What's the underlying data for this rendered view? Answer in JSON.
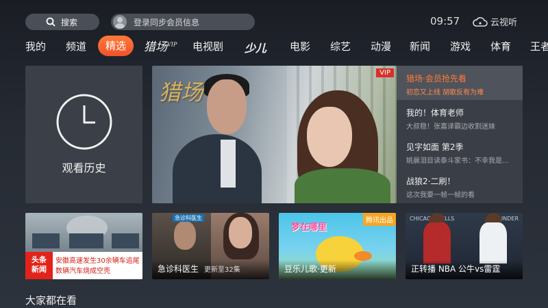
{
  "header": {
    "search_label": "搜索",
    "login_label": "登录同步会员信息",
    "time": "09:57",
    "brand": "云视听"
  },
  "nav": {
    "items": [
      {
        "label": "我的"
      },
      {
        "label": "频道"
      },
      {
        "label": "精选",
        "active": true
      },
      {
        "label": "猎场",
        "sup": "VIP"
      },
      {
        "label": "电视剧"
      },
      {
        "label": "少儿"
      },
      {
        "label": "电影"
      },
      {
        "label": "综艺"
      },
      {
        "label": "动漫"
      },
      {
        "label": "新闻"
      },
      {
        "label": "游戏"
      },
      {
        "label": "体育"
      },
      {
        "label": "王者"
      }
    ]
  },
  "history": {
    "label": "观看历史"
  },
  "hero": {
    "logo": "猎场",
    "vip_badge": "VIP"
  },
  "side_list": [
    {
      "title": "猎场·会员抢先看",
      "sub": "初恋又上线 胡歌反有为难",
      "selected": true
    },
    {
      "title": "我的！体育老师",
      "sub": "大叔稳！张嘉译霸边收割迷妹"
    },
    {
      "title": "见字如面 第2季",
      "sub": "姚晨泪目读泰斗家书：不幸我是..."
    },
    {
      "title": "战狼2·二刷！",
      "sub": "这次我要一帧一帧的看"
    }
  ],
  "tiles": {
    "news": {
      "badge_line1": "头条",
      "badge_line2": "新闻",
      "headline": "安徽高速发生30余辆车追尾 数辆汽车烧成空壳"
    },
    "drama": {
      "title": "急诊科医生",
      "sub": "更新至32集",
      "tag": "急诊科医生"
    },
    "kids": {
      "title": "豆乐儿歌·更新",
      "art_title": "梦在哪里",
      "badge": "腾讯出品"
    },
    "sports": {
      "title": "正转播 NBA 公牛vs雷霆",
      "team_left": "CHICAGO BULLS",
      "team_right": "THUNDER"
    }
  },
  "section": {
    "title": "大家都在看"
  },
  "colors": {
    "accent": "#f0532a",
    "vip": "#d9302b",
    "selected_text": "#ff7a3a"
  }
}
